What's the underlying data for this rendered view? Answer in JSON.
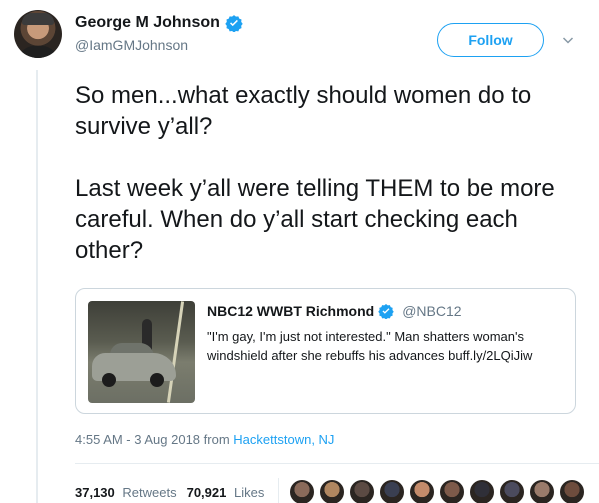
{
  "author": {
    "name": "George M Johnson",
    "handle": "@IamGMJohnson",
    "verified": true
  },
  "follow_label": "Follow",
  "tweet": {
    "paragraphs": [
      "So men...what exactly should women do to survive y’all?",
      "Last week y’all were telling THEM to be more careful. When do y’all start checking each other?"
    ]
  },
  "quoted": {
    "name": "NBC12 WWBT Richmond",
    "handle": "@NBC12",
    "verified": true,
    "text": "\"I'm gay, I'm just not interested.\" Man shatters woman's windshield after she rebuffs his advances buff.ly/2LQiJiw"
  },
  "meta": {
    "time": "4:55 AM - 3 Aug 2018 from",
    "location": "Hackettstown, NJ"
  },
  "stats": {
    "retweets_count": "37,130",
    "retweets_label": "Retweets",
    "likes_count": "70,921",
    "likes_label": "Likes"
  },
  "colors": {
    "accent": "#1da1f2",
    "muted": "#657786",
    "text": "#14171a"
  },
  "liker_avatars": [
    "#8a6a5a",
    "#b08660",
    "#5b4a43",
    "#3a3f52",
    "#c48b6b",
    "#7d5a4a",
    "#2f2f38",
    "#4b4b5e",
    "#9a7b6b",
    "#6d4c3d"
  ]
}
